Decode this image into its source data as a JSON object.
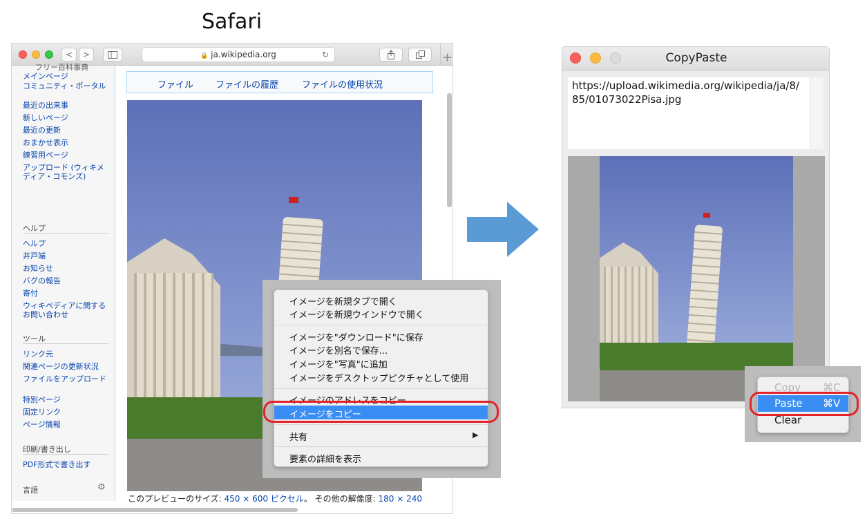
{
  "heading": "Safari",
  "safari": {
    "url": "ja.wikipedia.org",
    "lock_glyph": "🔒",
    "back_glyph": "<",
    "forward_glyph": ">",
    "reload_glyph": "↻",
    "newtab_glyph": "+",
    "logo_sub": "フリー百科事典",
    "sidebar": {
      "nav": [
        "メインページ",
        "コミュニティ・ポータル",
        "最近の出来事",
        "新しいページ",
        "最近の更新",
        "おまかせ表示",
        "練習用ページ",
        "アップロード (ウィキメディア・コモンズ)"
      ],
      "help_heading": "ヘルプ",
      "help": [
        "ヘルプ",
        "井戸端",
        "お知らせ",
        "バグの報告",
        "寄付",
        "ウィキペディアに関するお問い合わせ"
      ],
      "tools_heading": "ツール",
      "tools": [
        "リンク元",
        "関連ページの更新状況",
        "ファイルをアップロード",
        "特別ページ",
        "固定リンク",
        "ページ情報"
      ],
      "print_heading": "印刷/書き出し",
      "print": [
        "PDF形式で書き出す"
      ],
      "lang_heading": "言語",
      "gear_glyph": "⚙"
    },
    "file_tabs": [
      "ファイル",
      "ファイルの履歴",
      "ファイルの使用状況"
    ],
    "caption": {
      "prefix": "このプレビューのサイズ: ",
      "size": "450 × 600 ピクセル",
      "mid": "。 その他の解像度: ",
      "other": "180 × 240"
    }
  },
  "context_menu": {
    "items": [
      "イメージを新規タブで開く",
      "イメージを新規ウインドウで開く",
      "イメージを\"ダウンロード\"に保存",
      "イメージを別名で保存...",
      "イメージを\"写真\"に追加",
      "イメージをデスクトップピクチャとして使用",
      "イメージのアドレスをコピー",
      "イメージをコピー",
      "共有",
      "要素の詳細を表示"
    ],
    "highlighted": "イメージをコピー",
    "submenu_glyph": "▶"
  },
  "copypaste": {
    "title": "CopyPaste",
    "text": "https://upload.wikimedia.org/wikipedia/ja/8/85/01073022Pisa.jpg",
    "menu": {
      "copy": "Copy",
      "copy_key": "⌘C",
      "paste": "Paste",
      "paste_key": "⌘V",
      "clear": "Clear"
    }
  },
  "colors": {
    "highlight": "#3a8ef3",
    "ring": "#e2232a",
    "arrow": "#5b9bd5",
    "link": "#0645ad"
  }
}
